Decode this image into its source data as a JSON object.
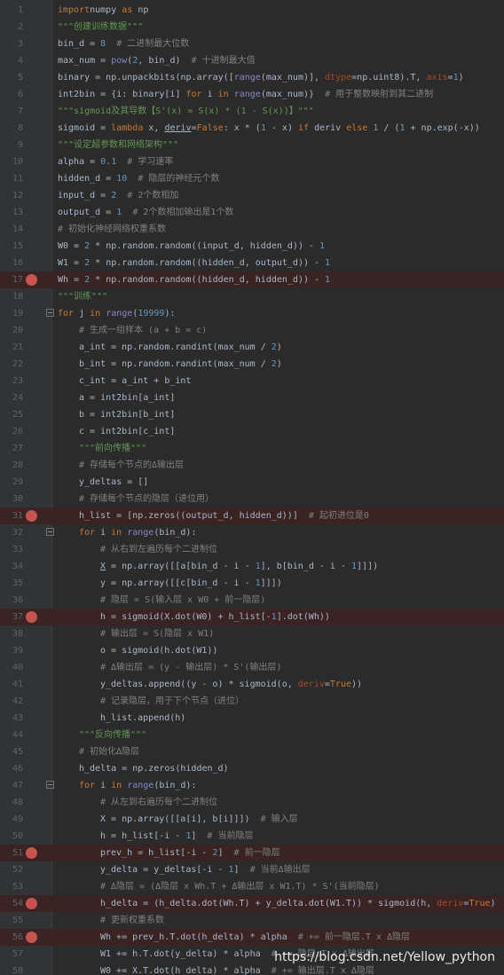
{
  "editor": {
    "lines": [
      {
        "n": "1",
        "ind": 0,
        "bp": false,
        "fold": false,
        "t": [
          [
            "kw",
            "import"
          ],
          [
            "",
            "numpy "
          ],
          [
            "kw",
            "as"
          ],
          [
            "",
            " np"
          ]
        ]
      },
      {
        "n": "2",
        "ind": 0,
        "bp": false,
        "fold": false,
        "t": [
          [
            "str",
            "\"\"\"创建训练数据\"\"\""
          ]
        ]
      },
      {
        "n": "3",
        "ind": 0,
        "bp": false,
        "fold": false,
        "t": [
          [
            "",
            "bin_d = "
          ],
          [
            "num",
            "8"
          ],
          [
            "",
            " "
          ],
          [
            "cm",
            " # 二进制最大位数"
          ]
        ]
      },
      {
        "n": "4",
        "ind": 0,
        "bp": false,
        "fold": false,
        "t": [
          [
            "",
            "max_num = "
          ],
          [
            "bi",
            "pow"
          ],
          [
            "",
            "("
          ],
          [
            "num",
            "2"
          ],
          [
            "",
            ", bin_d) "
          ],
          [
            "cm",
            " # 十进制最大值"
          ]
        ]
      },
      {
        "n": "5",
        "ind": 0,
        "bp": false,
        "fold": false,
        "t": [
          [
            "",
            "binary = np.unpackbits(np.array(["
          ],
          [
            "bi",
            "range"
          ],
          [
            "",
            "(max_num)], "
          ],
          [
            "kwarg",
            "dtype"
          ],
          [
            "",
            "=np.uint8).T, "
          ],
          [
            "kwarg",
            "axis"
          ],
          [
            "",
            "="
          ],
          [
            "num",
            "1"
          ],
          [
            "",
            ")"
          ]
        ]
      },
      {
        "n": "6",
        "ind": 0,
        "bp": false,
        "fold": false,
        "t": [
          [
            "",
            "int2bin = {i: binary[i] "
          ],
          [
            "kw",
            "for"
          ],
          [
            "",
            " i "
          ],
          [
            "kw",
            "in"
          ],
          [
            "",
            " "
          ],
          [
            "bi",
            "range"
          ],
          [
            "",
            "(max_num)} "
          ],
          [
            "cm",
            " # 用于整数映射到其二进制"
          ]
        ]
      },
      {
        "n": "7",
        "ind": 0,
        "bp": false,
        "fold": false,
        "t": [
          [
            "str",
            "\"\"\"sigmoid及其导数【S'(x) = S(x) * (1 - S(x))】\"\"\""
          ]
        ]
      },
      {
        "n": "8",
        "ind": 0,
        "bp": false,
        "fold": false,
        "t": [
          [
            "",
            "sigmoid = "
          ],
          [
            "kw",
            "lambda"
          ],
          [
            "",
            " x, "
          ],
          [
            "ul",
            "deriv"
          ],
          [
            "",
            "="
          ],
          [
            "kw",
            "False"
          ],
          [
            "",
            ": x * ("
          ],
          [
            "num",
            "1"
          ],
          [
            "",
            " - x) "
          ],
          [
            "kw",
            "if"
          ],
          [
            "",
            " deriv "
          ],
          [
            "kw",
            "else"
          ],
          [
            "",
            " "
          ],
          [
            "num",
            "1"
          ],
          [
            "",
            " / ("
          ],
          [
            "num",
            "1"
          ],
          [
            "",
            " + np.exp(-x))"
          ]
        ]
      },
      {
        "n": "9",
        "ind": 0,
        "bp": false,
        "fold": false,
        "t": [
          [
            "str",
            "\"\"\"设定超参数和网络架构\"\"\""
          ]
        ]
      },
      {
        "n": "10",
        "ind": 0,
        "bp": false,
        "fold": false,
        "t": [
          [
            "",
            "alpha = "
          ],
          [
            "num",
            "0.1"
          ],
          [
            "",
            " "
          ],
          [
            "cm",
            " # 学习速率"
          ]
        ]
      },
      {
        "n": "11",
        "ind": 0,
        "bp": false,
        "fold": false,
        "t": [
          [
            "",
            "hidden_d = "
          ],
          [
            "num",
            "10"
          ],
          [
            "",
            " "
          ],
          [
            "cm",
            " # 隐层的神经元个数"
          ]
        ]
      },
      {
        "n": "12",
        "ind": 0,
        "bp": false,
        "fold": false,
        "t": [
          [
            "",
            "input_d = "
          ],
          [
            "num",
            "2"
          ],
          [
            "",
            " "
          ],
          [
            "cm",
            " # 2个数相加"
          ]
        ]
      },
      {
        "n": "13",
        "ind": 0,
        "bp": false,
        "fold": false,
        "t": [
          [
            "",
            "output_d = "
          ],
          [
            "num",
            "1"
          ],
          [
            "",
            " "
          ],
          [
            "cm",
            " # 2个数相加输出是1个数"
          ]
        ]
      },
      {
        "n": "14",
        "ind": 0,
        "bp": false,
        "fold": false,
        "t": [
          [
            "cm",
            "# 初始化神经网络权重系数"
          ]
        ]
      },
      {
        "n": "15",
        "ind": 0,
        "bp": false,
        "fold": false,
        "t": [
          [
            "",
            "W0 = "
          ],
          [
            "num",
            "2"
          ],
          [
            "",
            " * np.random.random((input_d, hidden_d)) - "
          ],
          [
            "num",
            "1"
          ]
        ]
      },
      {
        "n": "16",
        "ind": 0,
        "bp": false,
        "fold": false,
        "t": [
          [
            "",
            "W1 = "
          ],
          [
            "num",
            "2"
          ],
          [
            "",
            " * np.random.random((hidden_d, output_d)) - "
          ],
          [
            "num",
            "1"
          ]
        ]
      },
      {
        "n": "17",
        "ind": 0,
        "bp": true,
        "fold": false,
        "t": [
          [
            "",
            "Wh = "
          ],
          [
            "num",
            "2"
          ],
          [
            "",
            " * np.random.random((hidden_d, hidden_d)) - "
          ],
          [
            "num",
            "1"
          ]
        ]
      },
      {
        "n": "18",
        "ind": 0,
        "bp": false,
        "fold": false,
        "t": [
          [
            "str",
            "\"\"\"训练\"\"\""
          ]
        ]
      },
      {
        "n": "19",
        "ind": 0,
        "bp": false,
        "fold": true,
        "t": [
          [
            "kw",
            "for"
          ],
          [
            "",
            " j "
          ],
          [
            "kw",
            "in"
          ],
          [
            "",
            " "
          ],
          [
            "bi",
            "range"
          ],
          [
            "",
            "("
          ],
          [
            "num",
            "19999"
          ],
          [
            "",
            "):"
          ]
        ]
      },
      {
        "n": "20",
        "ind": 1,
        "bp": false,
        "fold": false,
        "t": [
          [
            "cm",
            "# 生成一组样本 (a + b = c)"
          ]
        ]
      },
      {
        "n": "21",
        "ind": 1,
        "bp": false,
        "fold": false,
        "t": [
          [
            "",
            "a_int = np.random.randint(max_num / "
          ],
          [
            "num",
            "2"
          ],
          [
            "",
            ")"
          ]
        ]
      },
      {
        "n": "22",
        "ind": 1,
        "bp": false,
        "fold": false,
        "t": [
          [
            "",
            "b_int = np.random.randint(max_num / "
          ],
          [
            "num",
            "2"
          ],
          [
            "",
            ")"
          ]
        ]
      },
      {
        "n": "23",
        "ind": 1,
        "bp": false,
        "fold": false,
        "t": [
          [
            "",
            "c_int = a_int + b_int"
          ]
        ]
      },
      {
        "n": "24",
        "ind": 1,
        "bp": false,
        "fold": false,
        "t": [
          [
            "",
            "a = int2bin[a_int]"
          ]
        ]
      },
      {
        "n": "25",
        "ind": 1,
        "bp": false,
        "fold": false,
        "t": [
          [
            "",
            "b = int2bin[b_int]"
          ]
        ]
      },
      {
        "n": "26",
        "ind": 1,
        "bp": false,
        "fold": false,
        "t": [
          [
            "",
            "c = int2bin[c_int]"
          ]
        ]
      },
      {
        "n": "27",
        "ind": 1,
        "bp": false,
        "fold": false,
        "t": [
          [
            "str",
            "\"\"\"前向传播\"\"\""
          ]
        ]
      },
      {
        "n": "28",
        "ind": 1,
        "bp": false,
        "fold": false,
        "t": [
          [
            "cm",
            "# 存储每个节点的Δ输出层"
          ]
        ]
      },
      {
        "n": "29",
        "ind": 1,
        "bp": false,
        "fold": false,
        "t": [
          [
            "",
            "y_deltas = []"
          ]
        ]
      },
      {
        "n": "30",
        "ind": 1,
        "bp": false,
        "fold": false,
        "t": [
          [
            "cm",
            "# 存储每个节点的隐层（进位用）"
          ]
        ]
      },
      {
        "n": "31",
        "ind": 1,
        "bp": true,
        "fold": false,
        "t": [
          [
            "",
            "h_list = [np.zeros((output_d, hidden_d))] "
          ],
          [
            "cm",
            " # 起初进位是0"
          ]
        ]
      },
      {
        "n": "32",
        "ind": 1,
        "bp": false,
        "fold": true,
        "t": [
          [
            "kw",
            "for"
          ],
          [
            "",
            " i "
          ],
          [
            "kw",
            "in"
          ],
          [
            "",
            " "
          ],
          [
            "bi",
            "range"
          ],
          [
            "",
            "(bin_d):"
          ]
        ]
      },
      {
        "n": "33",
        "ind": 2,
        "bp": false,
        "fold": false,
        "t": [
          [
            "cm",
            "# 从右到左遍历每个二进制位"
          ]
        ]
      },
      {
        "n": "34",
        "ind": 2,
        "bp": false,
        "fold": false,
        "t": [
          [
            "ul",
            "X"
          ],
          [
            "",
            " = np.array([[a[bin_d - i - "
          ],
          [
            "num",
            "1"
          ],
          [
            "",
            "], b[bin_d - i - "
          ],
          [
            "num",
            "1"
          ],
          [
            "",
            "]]])"
          ]
        ]
      },
      {
        "n": "35",
        "ind": 2,
        "bp": false,
        "fold": false,
        "t": [
          [
            "",
            "y = np.array([[c[bin_d - i - "
          ],
          [
            "num",
            "1"
          ],
          [
            "",
            "]]])"
          ]
        ]
      },
      {
        "n": "36",
        "ind": 2,
        "bp": false,
        "fold": false,
        "t": [
          [
            "cm",
            "# 隐层 = S(输入层 x W0 + 前一隐层)"
          ]
        ]
      },
      {
        "n": "37",
        "ind": 2,
        "bp": true,
        "fold": false,
        "t": [
          [
            "",
            "h = sigmoid(X.dot(W0) + h_list[-"
          ],
          [
            "num",
            "1"
          ],
          [
            "",
            "].dot(Wh))"
          ]
        ]
      },
      {
        "n": "38",
        "ind": 2,
        "bp": false,
        "fold": false,
        "t": [
          [
            "cm",
            "# 输出层 = S(隐层 x W1)"
          ]
        ]
      },
      {
        "n": "39",
        "ind": 2,
        "bp": false,
        "fold": false,
        "t": [
          [
            "",
            "o = sigmoid(h.dot(W1))"
          ]
        ]
      },
      {
        "n": "40",
        "ind": 2,
        "bp": false,
        "fold": false,
        "t": [
          [
            "cm",
            "# Δ输出层 = (y - 输出层) * S'(输出层)"
          ]
        ]
      },
      {
        "n": "41",
        "ind": 2,
        "bp": false,
        "fold": false,
        "t": [
          [
            "",
            "y_deltas.append((y - o) * sigmoid(o, "
          ],
          [
            "kwarg",
            "deriv"
          ],
          [
            "",
            "="
          ],
          [
            "kw",
            "True"
          ],
          [
            "",
            "))"
          ]
        ]
      },
      {
        "n": "42",
        "ind": 2,
        "bp": false,
        "fold": false,
        "t": [
          [
            "cm",
            "# 记录隐层，用于下个节点（进位）"
          ]
        ]
      },
      {
        "n": "43",
        "ind": 2,
        "bp": false,
        "fold": false,
        "t": [
          [
            "",
            "h_list.append(h)"
          ]
        ]
      },
      {
        "n": "44",
        "ind": 1,
        "bp": false,
        "fold": false,
        "t": [
          [
            "str",
            "\"\"\"反向传播\"\"\""
          ]
        ]
      },
      {
        "n": "45",
        "ind": 1,
        "bp": false,
        "fold": false,
        "t": [
          [
            "cm",
            "# 初始化Δ隐层"
          ]
        ]
      },
      {
        "n": "46",
        "ind": 1,
        "bp": false,
        "fold": false,
        "t": [
          [
            "",
            "h_delta = np.zeros(hidden_d)"
          ]
        ]
      },
      {
        "n": "47",
        "ind": 1,
        "bp": false,
        "fold": true,
        "t": [
          [
            "kw",
            "for"
          ],
          [
            "",
            " i "
          ],
          [
            "kw",
            "in"
          ],
          [
            "",
            " "
          ],
          [
            "bi",
            "range"
          ],
          [
            "",
            "(bin_d):"
          ]
        ]
      },
      {
        "n": "48",
        "ind": 2,
        "bp": false,
        "fold": false,
        "t": [
          [
            "cm",
            "# 从左到右遍历每个二进制位"
          ]
        ]
      },
      {
        "n": "49",
        "ind": 2,
        "bp": false,
        "fold": false,
        "t": [
          [
            "",
            "X = np.array([[a[i], b[i]]]) "
          ],
          [
            "cm",
            " # 输入层"
          ]
        ]
      },
      {
        "n": "50",
        "ind": 2,
        "bp": false,
        "fold": false,
        "t": [
          [
            "",
            "h = h_list[-i - "
          ],
          [
            "num",
            "1"
          ],
          [
            "",
            "] "
          ],
          [
            "cm",
            " # 当前隐层"
          ]
        ]
      },
      {
        "n": "51",
        "ind": 2,
        "bp": true,
        "fold": false,
        "t": [
          [
            "",
            "prev_h = h_list[-i - "
          ],
          [
            "num",
            "2"
          ],
          [
            "",
            "] "
          ],
          [
            "cm",
            " # 前一隐层"
          ]
        ]
      },
      {
        "n": "52",
        "ind": 2,
        "bp": false,
        "fold": false,
        "t": [
          [
            "",
            "y_delta = y_deltas[-i - "
          ],
          [
            "num",
            "1"
          ],
          [
            "",
            "] "
          ],
          [
            "cm",
            " # 当前Δ输出层"
          ]
        ]
      },
      {
        "n": "53",
        "ind": 2,
        "bp": false,
        "fold": false,
        "t": [
          [
            "cm",
            "# Δ隐层 = (Δ隐层 x Wh.T + Δ输出层 x W1.T) * S'(当前隐层)"
          ]
        ]
      },
      {
        "n": "54",
        "ind": 2,
        "bp": true,
        "fold": false,
        "t": [
          [
            "",
            "h_delta = (h_delta.dot(Wh.T) + y_delta.dot(W1.T)) * sigmoid(h, "
          ],
          [
            "kwarg",
            "deriv"
          ],
          [
            "",
            "="
          ],
          [
            "kw",
            "True"
          ],
          [
            "",
            ")"
          ]
        ]
      },
      {
        "n": "55",
        "ind": 2,
        "bp": false,
        "fold": false,
        "t": [
          [
            "cm",
            "# 更新权重系数"
          ]
        ]
      },
      {
        "n": "56",
        "ind": 2,
        "bp": true,
        "fold": false,
        "t": [
          [
            "",
            "Wh += prev_h.T.dot(h_delta) * alpha "
          ],
          [
            "cm",
            " # += 前一隐层.T x Δ隐层"
          ]
        ]
      },
      {
        "n": "57",
        "ind": 2,
        "bp": false,
        "fold": false,
        "t": [
          [
            "",
            "W1 += h.T.dot(y_delta) * alpha "
          ],
          [
            "cm",
            " # += 隐层.T x Δ输出层"
          ]
        ]
      },
      {
        "n": "58",
        "ind": 2,
        "bp": false,
        "fold": false,
        "t": [
          [
            "",
            "W0 += X.T.dot(h_delta) * alpha "
          ],
          [
            "cm",
            " # += 输出层.T x Δ隐层"
          ]
        ]
      }
    ]
  },
  "watermark": "https://blog.csdn.net/Yellow_python",
  "colors": {
    "background": "#2b2b2b",
    "gutter": "#313335",
    "keyword": "#cc7832",
    "number": "#6897bb",
    "string": "#629755",
    "comment": "#808080",
    "builtin": "#8888c6",
    "kwarg": "#aa4926",
    "breakpoint": "#c75450",
    "breakpoint_line": "#3a2323"
  }
}
